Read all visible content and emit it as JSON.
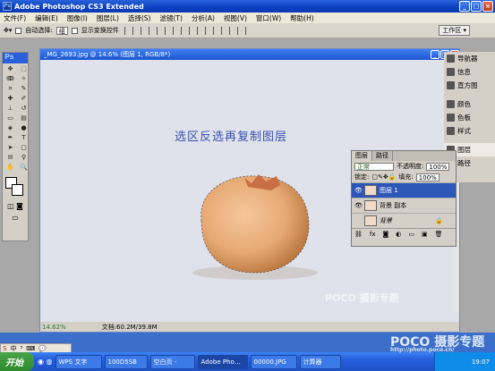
{
  "window": {
    "title": "Adobe Photoshop CS3 Extended",
    "icon": "Ps"
  },
  "menu": [
    "文件(F)",
    "编辑(E)",
    "图像(I)",
    "图层(L)",
    "选择(S)",
    "滤镜(T)",
    "分析(A)",
    "视图(V)",
    "窗口(W)",
    "帮助(H)"
  ],
  "options": {
    "auto_select": "自动选择:",
    "auto_select_value": "组",
    "show_transform": "显示变换控件",
    "workspace": "工作区 ▾"
  },
  "document": {
    "title": "_MG_2693.jpg @ 14.6% (图层 1, RGB/8*)",
    "zoom": "14.62%",
    "doc_info": "文档:60.2M/39.8M",
    "caption": "选区反选再复制图层"
  },
  "dock": [
    "导航器",
    "信息",
    "直方图",
    "颜色",
    "色板",
    "样式",
    "图层",
    "路径"
  ],
  "layers_panel": {
    "tabs": [
      "图层",
      "路径"
    ],
    "blend_mode": "正常",
    "opacity_label": "不透明度:",
    "opacity": "100%",
    "lock_label": "锁定:",
    "fill_label": "填充:",
    "fill": "100%",
    "layers": [
      {
        "name": "图层 1",
        "active": true
      },
      {
        "name": "背景 副本",
        "active": false
      },
      {
        "name": "背景",
        "active": false
      }
    ]
  },
  "taskbar": {
    "start": "开始",
    "tasks": [
      "WPS 文字",
      "100D5SB",
      "空白页 -",
      "Adobe Pho…",
      "00000.JPG",
      "计算器",
      ""
    ],
    "clock": "19:07"
  },
  "ime": [
    "S",
    "中",
    "⁵",
    "⌨",
    "💬"
  ],
  "watermark": [
    "POCO 摄影专题",
    "http://photo.poco.cn/"
  ],
  "colors": {
    "title_blue": "#0a3fc0",
    "egg": "#e7a974",
    "canvas_bg": "#dfe2ea",
    "active_layer": "#2c56b8"
  }
}
